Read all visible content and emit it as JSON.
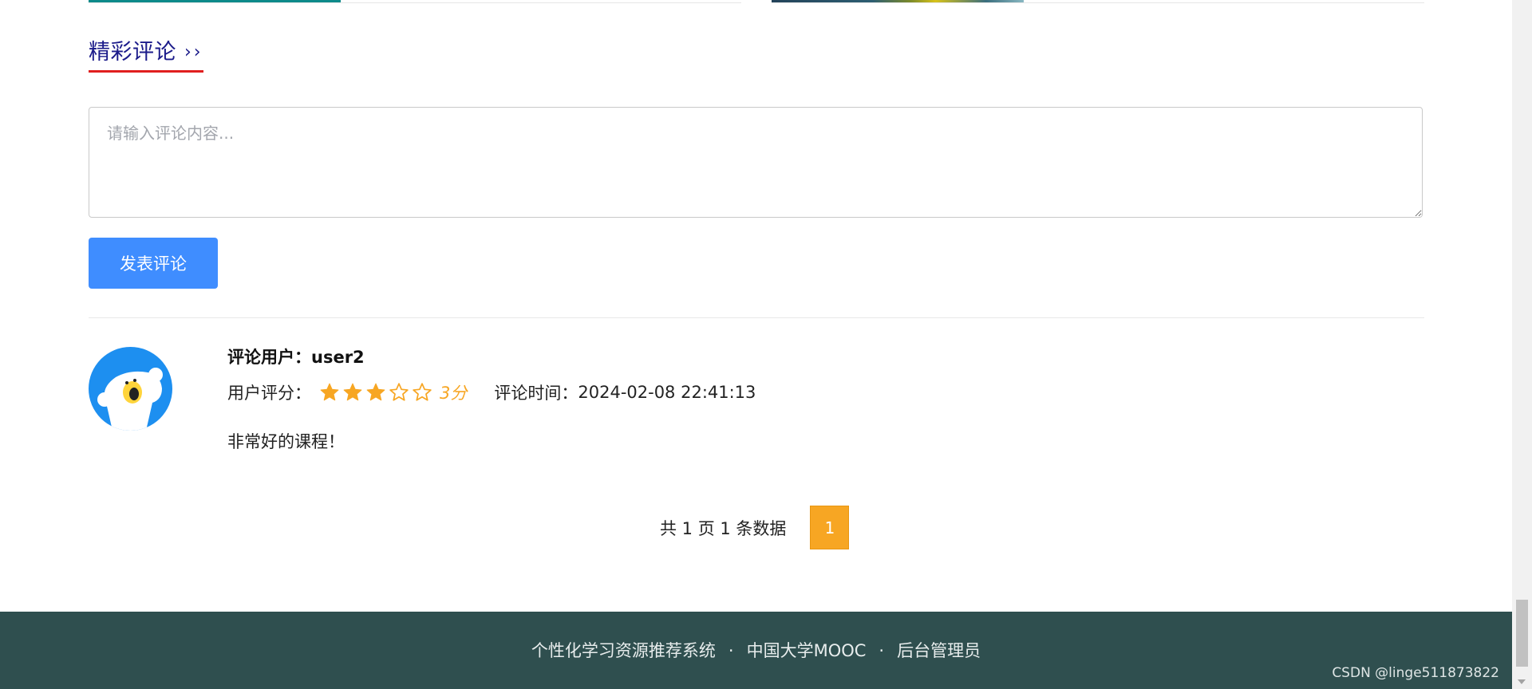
{
  "section": {
    "title": "精彩评论",
    "arrows": "››"
  },
  "comment_form": {
    "placeholder": "请输入评论内容...",
    "submit_label": "发表评论"
  },
  "comments": [
    {
      "user_label": "评论用户：",
      "username": "user2",
      "rating_label": "用户评分：",
      "rating": 3,
      "rating_max": 5,
      "rating_text": "3分",
      "time_label": "评论时间：",
      "time": "2024-02-08 22:41:13",
      "content": "非常好的课程！"
    }
  ],
  "pagination": {
    "summary": "共 1 页 1 条数据",
    "current_page": "1"
  },
  "footer": {
    "links": [
      "个性化学习资源推荐系统",
      "中国大学MOOC",
      "后台管理员"
    ],
    "separator": "·",
    "watermark": "CSDN @linge511873822"
  },
  "colors": {
    "title": "#1b1b8a",
    "title_underline": "#e01f1f",
    "button": "#3f8dff",
    "star": "#f7a623",
    "page_active": "#f7a623",
    "footer_bg": "#2f4f4f"
  },
  "icons": {
    "avatar": "bear-avatar-icon",
    "star_filled": "star-filled-icon",
    "star_empty": "star-outline-icon"
  }
}
